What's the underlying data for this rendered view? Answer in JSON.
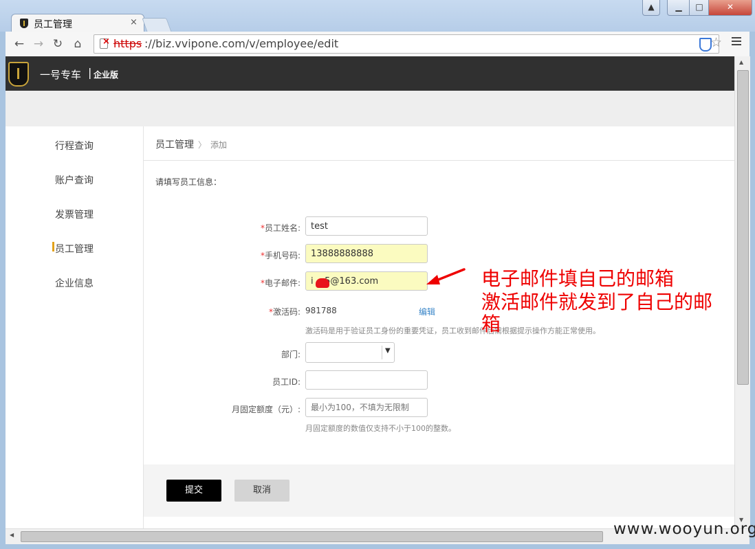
{
  "browser": {
    "tab_title": "员工管理",
    "tab_close": "×",
    "url_scheme": "https",
    "url_rest": "://biz.vvipone.com/v/employee/edit"
  },
  "site": {
    "name": "一号专车",
    "separator": "|",
    "edition": "企业版"
  },
  "sidebar": {
    "items": [
      {
        "label": "行程查询"
      },
      {
        "label": "账户查询"
      },
      {
        "label": "发票管理"
      },
      {
        "label": "员工管理",
        "active": true
      },
      {
        "label": "企业信息"
      }
    ]
  },
  "breadcrumb": {
    "section": "员工管理",
    "separator": "〉",
    "current": "添加"
  },
  "form": {
    "intro": "请填写员工信息：",
    "required_mark": "*",
    "name": {
      "label": "员工姓名:",
      "value": "test"
    },
    "phone": {
      "label": "手机号码:",
      "value": "13888888888"
    },
    "email": {
      "label": "电子邮件:",
      "value": "i    5@163.com"
    },
    "activation": {
      "label": "激活码:",
      "value": "981788",
      "edit_label": "编辑",
      "help": "激活码是用于验证员工身份的重要凭证，员工收到邮件后需根据提示操作方能正常使用。"
    },
    "department": {
      "label": "部门:",
      "value": ""
    },
    "employee_id": {
      "label": "员工ID:",
      "value": ""
    },
    "quota": {
      "label": "月固定额度（元）:",
      "placeholder": "最小为100，不填为无限制",
      "help": "月固定额度的数值仅支持不小于100的整数。"
    }
  },
  "actions": {
    "submit_label": "提交",
    "cancel_label": "取消"
  },
  "annotation": {
    "line1": "电子邮件填自己的邮箱",
    "line2": "激活邮件就发到了自己的邮",
    "line3": "箱",
    "color": "#e00000"
  },
  "watermark": "www.wooyun.org",
  "colors": {
    "header_bg": "#303030",
    "accent": "#e2a21a",
    "link": "#3a86c8",
    "autofill": "#fbfbc0"
  }
}
